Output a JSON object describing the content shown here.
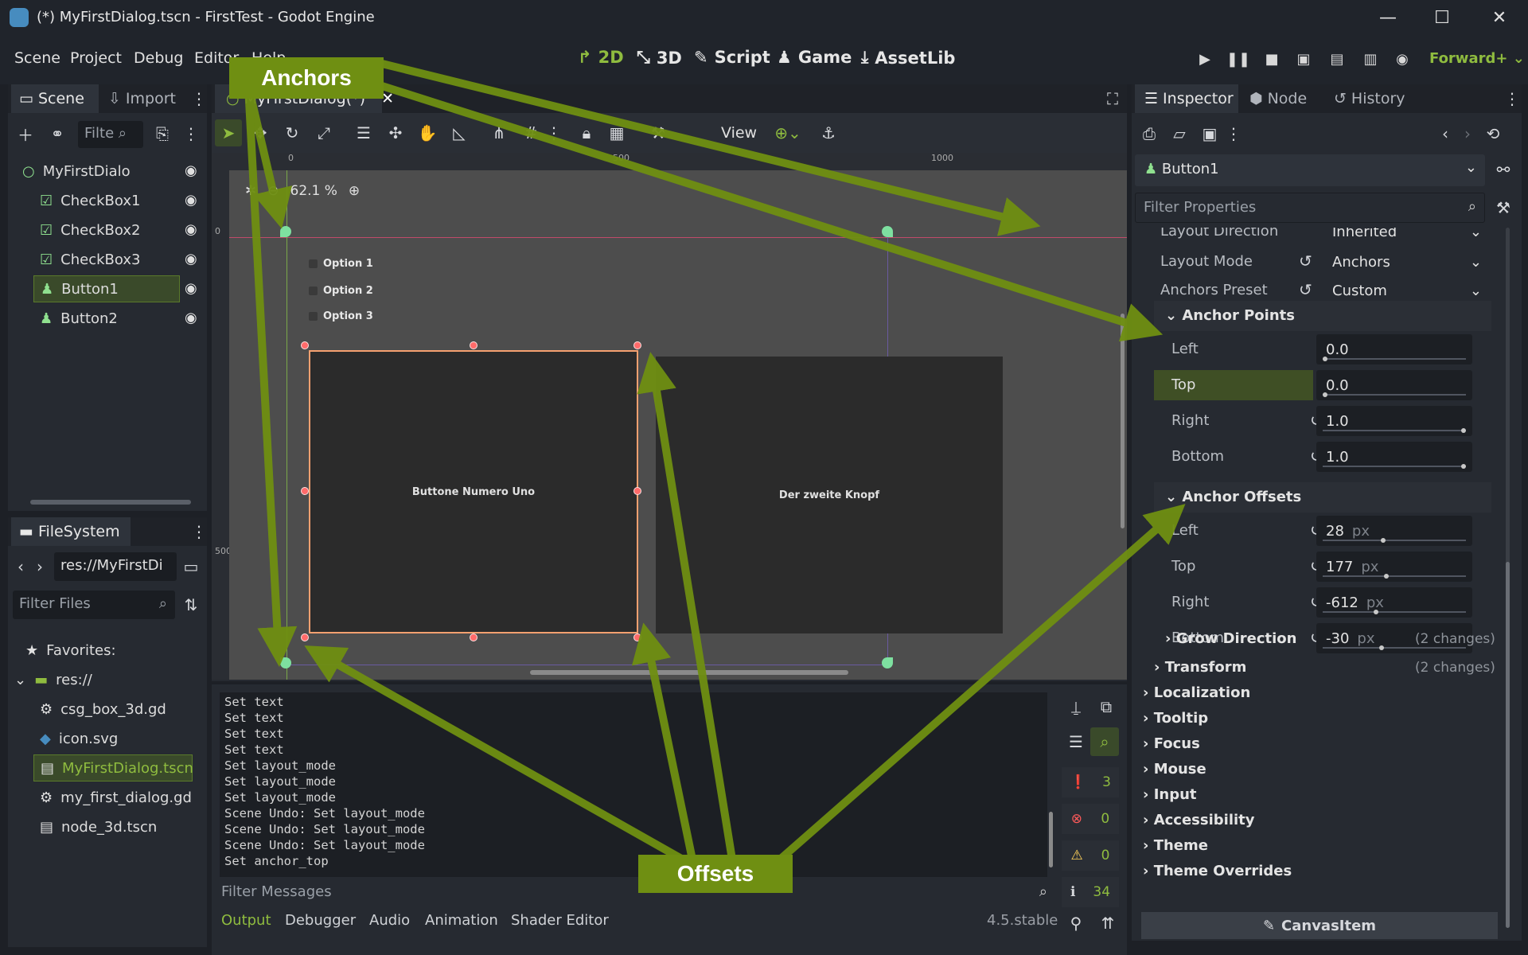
{
  "window": {
    "title": "(*) MyFirstDialog.tscn - FirstTest - Godot Engine",
    "minimize": "—",
    "maximize": "☐",
    "close": "✕"
  },
  "menu": [
    "Scene",
    "Project",
    "Debug",
    "Editor",
    "Help"
  ],
  "workspaces": [
    {
      "label": "2D",
      "icon": "2d-icon",
      "active": true
    },
    {
      "label": "3D",
      "icon": "3d-icon",
      "active": false
    },
    {
      "label": "Script",
      "icon": "script-icon",
      "active": false
    },
    {
      "label": "Game",
      "icon": "game-icon",
      "active": false
    },
    {
      "label": "AssetLib",
      "icon": "assetlib-icon",
      "active": false
    }
  ],
  "renderer": "Forward+",
  "scene_dock": {
    "tabs": [
      "Scene",
      "Import"
    ],
    "filter_placeholder": "Filte",
    "nodes": [
      {
        "name": "MyFirstDialo",
        "icon": "control-icon",
        "indent": 0,
        "selected": false
      },
      {
        "name": "CheckBox1",
        "icon": "checkbox-icon",
        "indent": 1,
        "selected": false
      },
      {
        "name": "CheckBox2",
        "icon": "checkbox-icon",
        "indent": 1,
        "selected": false
      },
      {
        "name": "CheckBox3",
        "icon": "checkbox-icon",
        "indent": 1,
        "selected": false
      },
      {
        "name": "Button1",
        "icon": "button-icon",
        "indent": 1,
        "selected": true
      },
      {
        "name": "Button2",
        "icon": "button-icon",
        "indent": 1,
        "selected": false
      }
    ]
  },
  "filesystem": {
    "tab": "FileSystem",
    "path": "res://MyFirstDi",
    "filter_placeholder": "Filter Files",
    "items": [
      {
        "name": "Favorites:",
        "icon": "star-icon",
        "indent": 0
      },
      {
        "name": "res://",
        "icon": "folder-icon",
        "indent": 0
      },
      {
        "name": "csg_box_3d.gd",
        "icon": "gear-icon",
        "indent": 1
      },
      {
        "name": "icon.svg",
        "icon": "image-icon",
        "indent": 1
      },
      {
        "name": "MyFirstDialog.tscn",
        "icon": "scene-icon",
        "indent": 1,
        "selected": true
      },
      {
        "name": "my_first_dialog.gd",
        "icon": "gear-icon",
        "indent": 1
      },
      {
        "name": "node_3d.tscn",
        "icon": "scene-icon",
        "indent": 1
      }
    ]
  },
  "editor": {
    "scene_tab": "MyFirstDialog(*)",
    "view_menu": "View",
    "zoom": "62.1 %",
    "ruler_labels": [
      "0",
      "500",
      "1000"
    ],
    "ruler_v_labels": [
      "0",
      "500"
    ],
    "options": [
      "Option 1",
      "Option 2",
      "Option 3"
    ],
    "button1": "Buttone Numero Uno",
    "button2": "Der zweite Knopf"
  },
  "output": {
    "lines": [
      "Set text",
      "Set text",
      "Set text",
      "Set text",
      "Set layout_mode",
      "Set layout_mode",
      "Set layout_mode",
      "Scene Undo: Set layout_mode",
      "Scene Undo: Set layout_mode",
      "Scene Undo: Set layout_mode",
      "Set anchor_top"
    ],
    "filter_placeholder": "Filter Messages",
    "counters": {
      "messages": "3",
      "errors": "0",
      "warnings": "0",
      "all": "34"
    },
    "bottom_tabs": [
      "Output",
      "Debugger",
      "Audio",
      "Animation",
      "Shader Editor"
    ],
    "version": "4.5.stable"
  },
  "inspector": {
    "tabs": [
      "Inspector",
      "Node",
      "History"
    ],
    "node": "Button1",
    "filter_placeholder": "Filter Properties",
    "layout_direction": {
      "label": "Layout Direction",
      "value": "Inherited"
    },
    "layout_mode": {
      "label": "Layout Mode",
      "value": "Anchors"
    },
    "anchors_preset": {
      "label": "Anchors Preset",
      "value": "Custom"
    },
    "anchor_points": {
      "title": "Anchor Points",
      "rows": [
        {
          "label": "Left",
          "value": "0.0",
          "fill": 0.0,
          "revert": false
        },
        {
          "label": "Top",
          "value": "0.0",
          "fill": 0.0,
          "revert": false
        },
        {
          "label": "Right",
          "value": "1.0",
          "fill": 1.0,
          "revert": true
        },
        {
          "label": "Bottom",
          "value": "1.0",
          "fill": 1.0,
          "revert": true
        }
      ]
    },
    "anchor_offsets": {
      "title": "Anchor Offsets",
      "unit": "px",
      "rows": [
        {
          "label": "Left",
          "value": "28"
        },
        {
          "label": "Top",
          "value": "177"
        },
        {
          "label": "Right",
          "value": "-612"
        },
        {
          "label": "Bottom",
          "value": "-30"
        }
      ]
    },
    "grow_direction": {
      "label": "Grow Direction",
      "changes": "(2 changes)"
    },
    "transform": {
      "label": "Transform",
      "changes": "(2 changes)"
    },
    "sections": [
      "Localization",
      "Tooltip",
      "Focus",
      "Mouse",
      "Input",
      "Accessibility",
      "Theme",
      "Theme Overrides"
    ],
    "footer": "CanvasItem"
  },
  "annotations": {
    "anchors": "Anchors",
    "offsets": "Offsets",
    "color": "#6f8f12"
  }
}
